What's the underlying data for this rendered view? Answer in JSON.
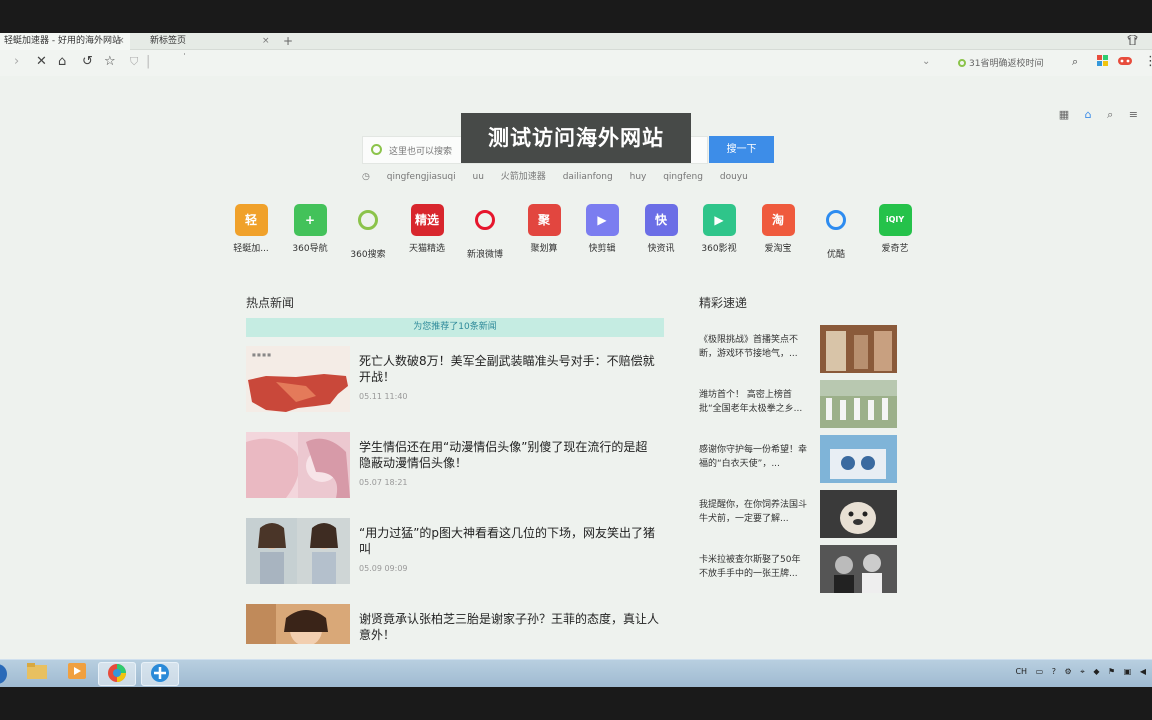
{
  "tabs": [
    {
      "label": "轻蜓加速器 - 好用的海外网站",
      "close": "×",
      "active": true
    },
    {
      "label": "新标签页",
      "close": "×",
      "active": false
    }
  ],
  "newtab_label": "+",
  "toolbar": {
    "icons": [
      "chevron-right-icon",
      "close-icon",
      "home-icon",
      "undo-icon",
      "star-icon",
      "shield-icon"
    ],
    "address_text": "˙",
    "dropdown_glyph": "⌄",
    "news_ticker": "31省明确返校时间"
  },
  "page": {
    "overlay_title": "测试访问海外网站",
    "search": {
      "placeholder": "这里也可以搜索",
      "button": "搜一下"
    },
    "hot_words": [
      "qingfengjiasuqi",
      "uu",
      "火箭加速器",
      "dailianfong",
      "huy",
      "qingfeng",
      "douyu"
    ],
    "apps": [
      {
        "label": "轻蜓加...",
        "glyph": "轻",
        "color": "#f0a12a"
      },
      {
        "label": "360导航",
        "glyph": "+",
        "color": "#43c25a"
      },
      {
        "label": "360搜索",
        "glyph": "",
        "color": "transparent"
      },
      {
        "label": "天猫精选",
        "glyph": "精选",
        "color": "#d8262d"
      },
      {
        "label": "新浪微博",
        "glyph": "",
        "color": "transparent"
      },
      {
        "label": "聚划算",
        "glyph": "聚",
        "color": "#e2463f"
      },
      {
        "label": "快剪辑",
        "glyph": "▶",
        "color": "#7b7df0"
      },
      {
        "label": "快资讯",
        "glyph": "快",
        "color": "#6b6ee6"
      },
      {
        "label": "360影视",
        "glyph": "▶",
        "color": "#2fc58a"
      },
      {
        "label": "爱淘宝",
        "glyph": "淘",
        "color": "#ef5a3d"
      },
      {
        "label": "优酷",
        "glyph": "",
        "color": "transparent"
      },
      {
        "label": "爱奇艺",
        "glyph": "iQIY",
        "color": "#25c24a"
      }
    ],
    "hot_news_title": "热点新闻",
    "banner": "为您推荐了10条新闻",
    "news": [
      {
        "title": "死亡人数破8万！美军全副武装瞄准头号对手：不赔偿就开战！",
        "time": "05.11 11:40"
      },
      {
        "title": "学生情侣还在用“动漫情侣头像”别傻了现在流行的是超隐蔽动漫情侣头像！",
        "time": "05.07 18:21"
      },
      {
        "title": "“用力过猛”的p图大神看看这几位的下场，网友笑出了猪叫",
        "time": "05.09 09:09"
      },
      {
        "title": "谢贤竟承认张柏芝三胎是谢家子孙？王菲的态度，真让人意外！",
        "time": ""
      }
    ],
    "quick_title": "精彩速递",
    "quick": [
      {
        "text": "《极限挑战》首播笑点不断，游戏环节接地气，..."
      },
      {
        "text": "潍坊首个！ 高密上榜首批“全国老年太极拳之乡..."
      },
      {
        "text": "感谢你守护每一份希望！幸福的“白衣天使”，..."
      },
      {
        "text": "我提醒你，在你饲养法国斗牛犬前，一定要了解..."
      },
      {
        "text": "卡米拉被查尔斯娶了50年不放手手中的一张王牌..."
      }
    ]
  },
  "tray_text": "CH"
}
